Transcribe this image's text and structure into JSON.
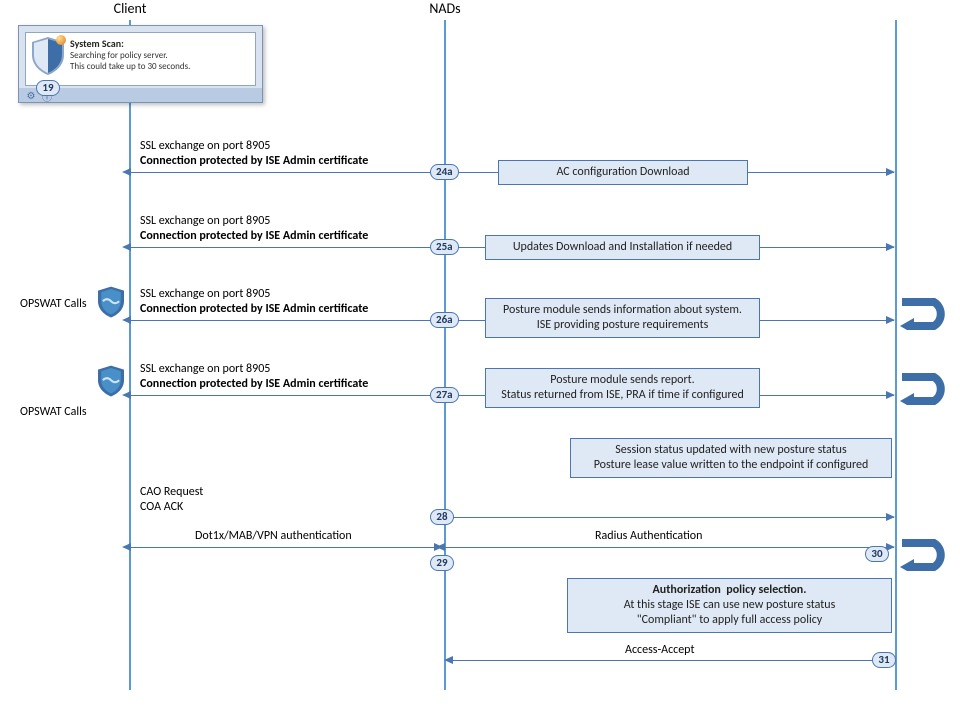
{
  "lifelines": {
    "client": "Client",
    "nads": "NADs"
  },
  "scan_panel": {
    "title": "System Scan:",
    "line1": "Searching for policy server.",
    "line2": "This could take up to 30 seconds.",
    "step": "19",
    "gear": "⚙",
    "info": "ⓘ"
  },
  "opswat_label_1": "OPSWAT Calls",
  "opswat_label_2": "OPSWAT Calls",
  "ssl_line1": "SSL exchange on port 8905",
  "ssl_line2": "Connection  protected by ISE Admin certificate",
  "steps": {
    "s24a": "24a",
    "s25a": "25a",
    "s26a": "26a",
    "s27a": "27a",
    "s28": "28",
    "s29": "29",
    "s30": "30",
    "s31": "31"
  },
  "boxes": {
    "b24": "AC configuration Download",
    "b25": "Updates Download and Installation if needed",
    "b26": "Posture module sends information about system. ISE providing posture requirements",
    "b27": "Posture module sends report.\nStatus returned from ISE, PRA if time if configured",
    "b_session": "Session status updated with new posture status\nPosture lease value written to the endpoint if configured",
    "b_auth": "Authorization  policy selection.\nAt this stage ISE can use new posture status \"Compliant\" to apply full access policy"
  },
  "msgs": {
    "cao_req": "CAO Request",
    "coa_ack": "COA ACK",
    "dot1x": "Dot1x/MAB/VPN  authentication",
    "radius": "Radius Authentication",
    "access": "Access-Accept"
  }
}
